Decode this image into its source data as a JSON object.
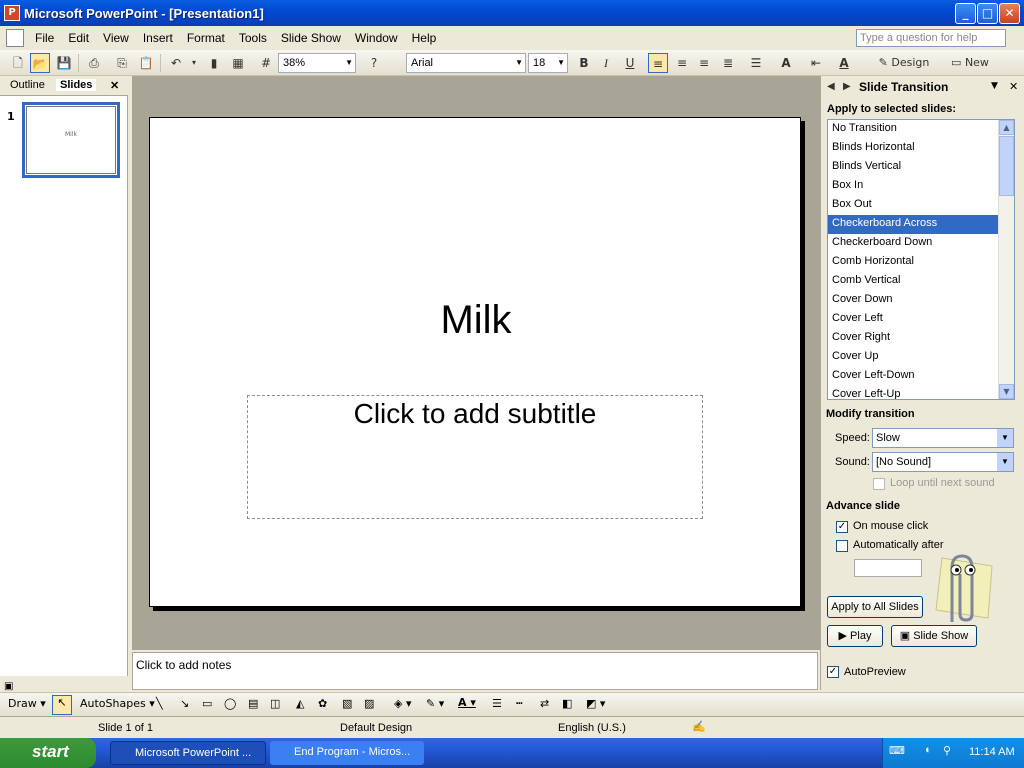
{
  "window": {
    "title": "Microsoft PowerPoint - [Presentation1]",
    "min": "_",
    "max": "□",
    "close": "✕"
  },
  "menu": [
    "File",
    "Edit",
    "View",
    "Insert",
    "Format",
    "Tools",
    "Slide Show",
    "Window",
    "Help"
  ],
  "help_placeholder": "Type a question for help",
  "toolbar": {
    "zoom": "38%",
    "font": "Arial",
    "size": "18",
    "design": "Design",
    "new_slide": "New Slide",
    "bold": "B",
    "italic": "I",
    "underline": "U"
  },
  "left_pane": {
    "tab_outline": "Outline",
    "tab_slides": "Slides",
    "slide_number": "1",
    "thumb_text": "Milk"
  },
  "slide": {
    "title": "Milk",
    "subtitle_placeholder": "Click to add subtitle"
  },
  "notes_placeholder": "Click to add notes",
  "task_pane": {
    "title": "Slide Transition",
    "apply_label": "Apply to selected slides:",
    "transitions": [
      "No Transition",
      "Blinds Horizontal",
      "Blinds Vertical",
      "Box In",
      "Box Out",
      "Checkerboard Across",
      "Checkerboard Down",
      "Comb Horizontal",
      "Comb Vertical",
      "Cover Down",
      "Cover Left",
      "Cover Right",
      "Cover Up",
      "Cover Left-Down",
      "Cover Left-Up"
    ],
    "selected_index": 5,
    "modify_label": "Modify transition",
    "speed_label": "Speed:",
    "speed_value": "Slow",
    "sound_label": "Sound:",
    "sound_value": "[No Sound]",
    "loop_label": "Loop until next sound",
    "advance_label": "Advance slide",
    "on_click_label": "On mouse click",
    "on_click_checked": true,
    "auto_label": "Automatically after",
    "auto_checked": false,
    "apply_all": "Apply to All Slides",
    "play": "Play",
    "slide_show": "Slide Show",
    "autopreview": "AutoPreview",
    "autopreview_checked": true
  },
  "drawbar": {
    "draw": "Draw",
    "autoshapes": "AutoShapes"
  },
  "status": {
    "slide": "Slide 1 of 1",
    "design": "Default Design",
    "language": "English (U.S.)"
  },
  "taskbar": {
    "start": "start",
    "tasks": [
      "Microsoft PowerPoint ...",
      "End Program - Micros..."
    ],
    "time": "11:14 AM"
  },
  "colors": {
    "title_bar": "#0149d2",
    "selection": "#316ac5",
    "workspace": "#a8a597"
  }
}
